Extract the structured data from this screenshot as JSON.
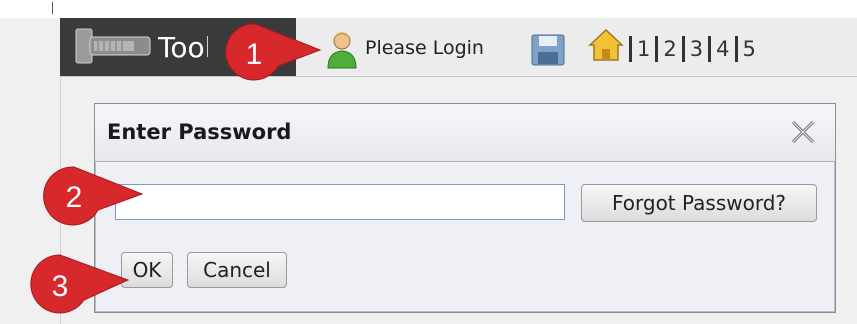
{
  "toolbar": {
    "app_title": "Tools",
    "login_label": "Please Login",
    "page_numbers": [
      "1",
      "2",
      "3",
      "4",
      "5"
    ]
  },
  "dialog": {
    "title": "Enter Password",
    "password_value": "",
    "forgot_label": "Forgot Password?",
    "ok_label": "OK",
    "cancel_label": "Cancel"
  },
  "callouts": [
    "1",
    "2",
    "3"
  ],
  "icons": {
    "app": "tool-wrench-icon",
    "login": "user-icon",
    "save": "floppy-disk-icon",
    "home": "home-icon",
    "close": "close-icon"
  },
  "colors": {
    "callout_red": "#d7282c",
    "toolbar_dark": "#3a3a3a",
    "dialog_bg": "#eef0f5"
  }
}
